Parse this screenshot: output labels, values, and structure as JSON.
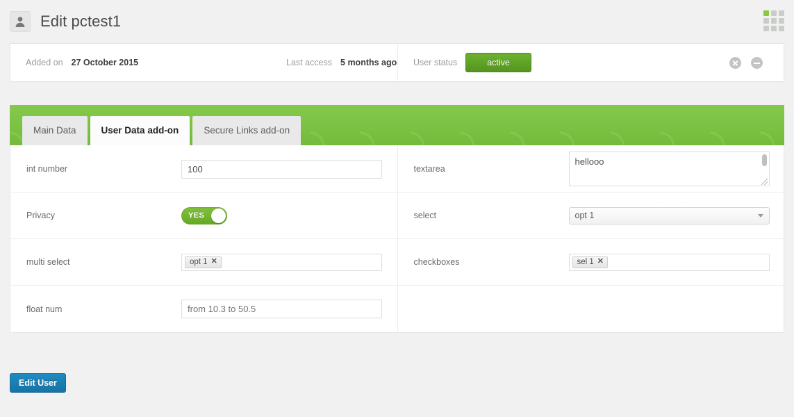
{
  "header": {
    "title": "Edit pctest1",
    "avatar_icon": "user-avatar-icon",
    "grid_icon": "grid-menu-icon"
  },
  "info_bar": {
    "added_label": "Added on",
    "added_value": "27 October 2015",
    "last_access_label": "Last access",
    "last_access_value": "5 months ago",
    "status_label": "User status",
    "status_value": "active",
    "status_color": "#5fa326",
    "actions": [
      {
        "icon": "close-circle-icon"
      },
      {
        "icon": "minus-circle-icon"
      }
    ]
  },
  "tabs": {
    "bar_color": "#7ac143",
    "items": [
      {
        "label": "Main Data",
        "active": false
      },
      {
        "label": "User Data add-on",
        "active": true
      },
      {
        "label": "Secure Links add-on",
        "active": false
      }
    ]
  },
  "form": {
    "left": [
      {
        "label": "int number",
        "type": "text",
        "value": "100",
        "placeholder": ""
      },
      {
        "label": "Privacy",
        "type": "toggle",
        "value": "YES"
      },
      {
        "label": "multi select",
        "type": "tags",
        "tags": [
          "opt 1"
        ]
      },
      {
        "label": "float num",
        "type": "text",
        "value": "",
        "placeholder": "from 10.3 to 50.5"
      }
    ],
    "right": [
      {
        "label": "textarea",
        "type": "textarea",
        "value": "hellooo"
      },
      {
        "label": "select",
        "type": "select",
        "value": "opt 1"
      },
      {
        "label": "checkboxes",
        "type": "tags",
        "tags": [
          "sel 1"
        ]
      }
    ]
  },
  "footer": {
    "submit_label": "Edit User",
    "submit_color": "#1c7fb3"
  },
  "chip_remove_glyph": "✕"
}
